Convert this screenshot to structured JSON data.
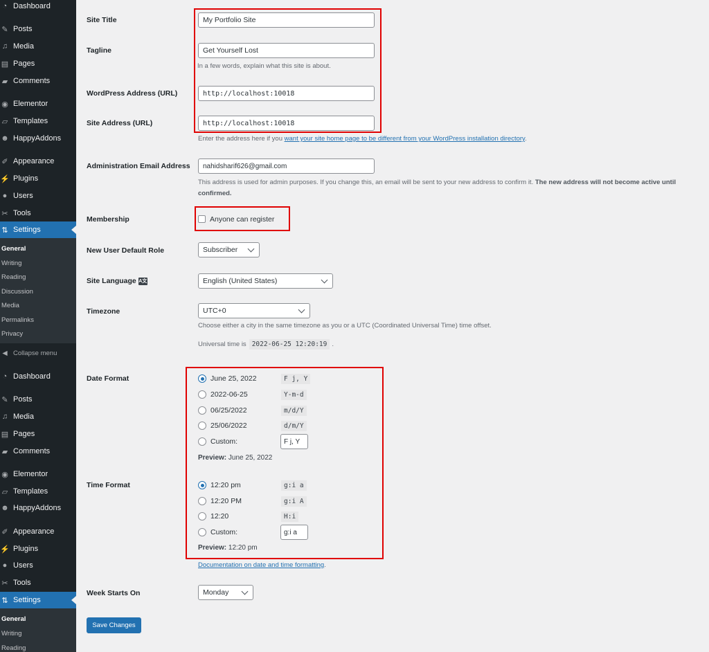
{
  "sidebar": {
    "menu_top": [
      {
        "label": "Dashboard",
        "icon": "dashboard-icon"
      },
      {
        "label": "Posts",
        "icon": "pin-icon"
      },
      {
        "label": "Media",
        "icon": "media-icon"
      },
      {
        "label": "Pages",
        "icon": "pages-icon"
      },
      {
        "label": "Comments",
        "icon": "comment-icon"
      },
      {
        "label": "Elementor",
        "icon": "elementor-icon"
      },
      {
        "label": "Templates",
        "icon": "folder-icon"
      },
      {
        "label": "HappyAddons",
        "icon": "happy-face-icon"
      },
      {
        "label": "Appearance",
        "icon": "brush-icon"
      },
      {
        "label": "Plugins",
        "icon": "plug-icon"
      },
      {
        "label": "Users",
        "icon": "user-icon"
      },
      {
        "label": "Tools",
        "icon": "wrench-icon"
      },
      {
        "label": "Settings",
        "icon": "settings-icon",
        "active": true
      }
    ],
    "submenu": [
      {
        "label": "General",
        "current": true
      },
      {
        "label": "Writing"
      },
      {
        "label": "Reading"
      },
      {
        "label": "Discussion"
      },
      {
        "label": "Media"
      },
      {
        "label": "Permalinks"
      },
      {
        "label": "Privacy"
      }
    ],
    "collapse_label": "Collapse menu",
    "menu_bottom": [
      {
        "label": "Dashboard"
      },
      {
        "label": "Posts"
      },
      {
        "label": "Media"
      },
      {
        "label": "Pages"
      },
      {
        "label": "Comments"
      },
      {
        "label": "Elementor"
      },
      {
        "label": "Templates"
      },
      {
        "label": "HappyAddons"
      },
      {
        "label": "Appearance"
      },
      {
        "label": "Plugins"
      },
      {
        "label": "Users"
      },
      {
        "label": "Tools"
      },
      {
        "label": "Settings",
        "active": true
      }
    ],
    "submenu_bottom": [
      {
        "label": "General",
        "current": true
      },
      {
        "label": "Writing"
      },
      {
        "label": "Reading"
      }
    ]
  },
  "form": {
    "site_title": {
      "label": "Site Title",
      "value": "My Portfolio Site"
    },
    "tagline": {
      "label": "Tagline",
      "value": "Get Yourself Lost",
      "description": "In a few words, explain what this site is about."
    },
    "wp_address": {
      "label": "WordPress Address (URL)",
      "value": "http://localhost:10018"
    },
    "site_address": {
      "label": "Site Address (URL)",
      "value": "http://localhost:10018",
      "description_prefix": "Enter the address here if you ",
      "description_link": "want your site home page to be different from your WordPress installation directory",
      "description_suffix": "."
    },
    "admin_email": {
      "label": "Administration Email Address",
      "value": "nahidsharif626@gmail.com",
      "description": "This address is used for admin purposes. If you change this, an email will be sent to your new address to confirm it. ",
      "description_bold": "The new address will not become active until confirmed."
    },
    "membership": {
      "label": "Membership",
      "checkbox_label": "Anyone can register",
      "checked": false
    },
    "default_role": {
      "label": "New User Default Role",
      "value": "Subscriber"
    },
    "site_language": {
      "label": "Site Language",
      "value": "English (United States)",
      "icon": "translation-icon"
    },
    "timezone": {
      "label": "Timezone",
      "value": "UTC+0",
      "description": "Choose either a city in the same timezone as you or a UTC (Coordinated Universal Time) time offset.",
      "universal_prefix": "Universal time is",
      "universal_time": "2022-06-25 12:20:19",
      "universal_suffix": "."
    },
    "date_format": {
      "label": "Date Format",
      "options": [
        {
          "label": "June 25, 2022",
          "code": "F j, Y",
          "checked": true
        },
        {
          "label": "2022-06-25",
          "code": "Y-m-d"
        },
        {
          "label": "06/25/2022",
          "code": "m/d/Y"
        },
        {
          "label": "25/06/2022",
          "code": "d/m/Y"
        },
        {
          "label": "Custom:",
          "custom_value": "F j, Y"
        }
      ],
      "preview_label": "Preview:",
      "preview_value": "June 25, 2022"
    },
    "time_format": {
      "label": "Time Format",
      "options": [
        {
          "label": "12:20 pm",
          "code": "g:i a",
          "checked": true
        },
        {
          "label": "12:20 PM",
          "code": "g:i A"
        },
        {
          "label": "12:20",
          "code": "H:i"
        },
        {
          "label": "Custom:",
          "custom_value": "g:i a"
        }
      ],
      "preview_label": "Preview:",
      "preview_value": "12:20 pm",
      "doc_link": "Documentation on date and time formatting",
      "doc_suffix": "."
    },
    "week_starts": {
      "label": "Week Starts On",
      "value": "Monday"
    },
    "save_label": "Save Changes"
  },
  "colors": {
    "accent": "#2271b1",
    "sidebar_bg": "#1d2327",
    "highlight_box": "#e00000"
  }
}
